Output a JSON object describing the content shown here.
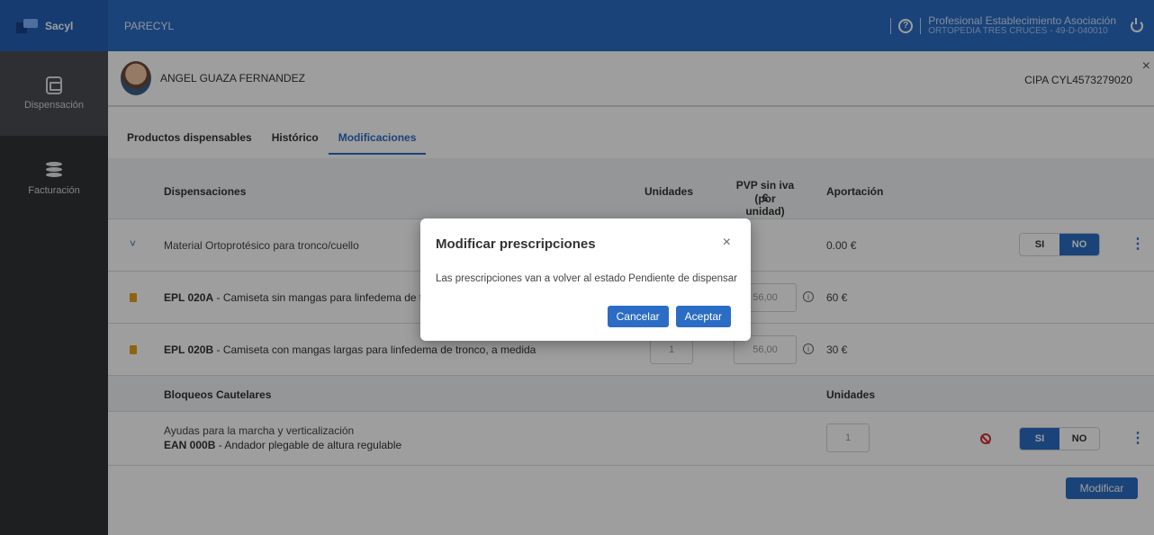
{
  "topbar": {
    "logo_text": "Sacyl",
    "app_name": "PARECYL",
    "help_icon": "help-circle-icon",
    "user_role": "Profesional Establecimiento Asociación",
    "establishment": "ORTOPEDIA TRES CRUCES - 49-D-040010",
    "power_icon": "power-icon"
  },
  "sidebar": {
    "items": [
      {
        "label": "Dispensación",
        "icon": "save-disk-icon",
        "active": true
      },
      {
        "label": "Facturación",
        "icon": "coins-icon",
        "active": false
      }
    ]
  },
  "patient": {
    "name": "ANGEL GUAZA FERNANDEZ",
    "cipa": "CIPA CYL4573279020",
    "close": "×"
  },
  "tabs": [
    {
      "label": "Productos dispensables",
      "active": false
    },
    {
      "label": "Histórico",
      "active": false
    },
    {
      "label": "Modificaciones",
      "active": true
    }
  ],
  "table": {
    "headers": {
      "dispensaciones": "Dispensaciones",
      "unidades": "Unidades",
      "pvp": "PVP sin iva €",
      "pvp_sub": "(por unidad)",
      "aportacion": "Aportación"
    },
    "group": {
      "chevron": "˅",
      "label": "Material Ortoprotésico para tronco/cuello",
      "aportacion": "0.00 €",
      "si": "SI",
      "no": "NO",
      "selected": "NO"
    },
    "items": [
      {
        "code": "EPL 020A",
        "desc": " - Camiseta sin mangas para linfedema de tronco, a medida",
        "units": "1",
        "pvp": "56,00",
        "aportacion": "60 €"
      },
      {
        "code": "EPL 020B",
        "desc": " - Camiseta con mangas largas para linfedema de tronco, a medida",
        "units": "1",
        "pvp": "56,00",
        "aportacion": "30 €"
      }
    ],
    "bloqueos": {
      "header": "Bloqueos Cautelares",
      "unidades": "Unidades",
      "category": "Ayudas para la marcha y verticalización",
      "code": "EAN 000B",
      "desc": " - Andador plegable de altura regulable",
      "units": "1",
      "si": "SI",
      "no": "NO",
      "selected": "SI"
    },
    "modify_button": "Modificar"
  },
  "modal": {
    "title": "Modificar prescripciones",
    "close": "×",
    "body": "Las prescripciones van a volver al estado Pendiente de dispensar",
    "cancel": "Cancelar",
    "accept": "Aceptar"
  },
  "colors": {
    "primary": "#2b6cc4",
    "sidebar": "#2f3236",
    "doc_icon": "#e8a01b",
    "block_icon": "#d32f2f"
  }
}
